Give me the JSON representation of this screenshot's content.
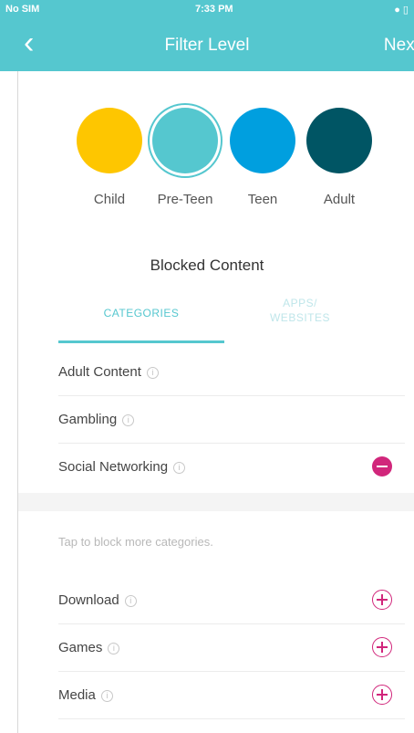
{
  "status_bar": {
    "carrier": "No SIM",
    "time": "7:33 PM",
    "battery": "● ▯"
  },
  "header": {
    "back_icon": "‹",
    "title": "Filter Level",
    "next_label": "Next"
  },
  "levels": [
    {
      "name": "Child",
      "color": "#fec600",
      "selected": false
    },
    {
      "name": "Pre-Teen",
      "color": "#55c7cf",
      "selected": true
    },
    {
      "name": "Teen",
      "color": "#009fdf",
      "selected": false
    },
    {
      "name": "Adult",
      "color": "#005564",
      "selected": false
    }
  ],
  "blocked_title": "Blocked Content",
  "tabs": {
    "categories_label": "CATEGORIES",
    "apps_label_line1": "APPS/",
    "apps_label_line2": "WEBSITES"
  },
  "blocked_categories": [
    {
      "label": "Adult Content",
      "action": "none"
    },
    {
      "label": "Gambling",
      "action": "none"
    },
    {
      "label": "Social Networking",
      "action": "remove"
    }
  ],
  "hint_text": "Tap to block more categories.",
  "more_categories": [
    {
      "label": "Download",
      "action": "add"
    },
    {
      "label": "Games",
      "action": "add"
    },
    {
      "label": "Media",
      "action": "add"
    }
  ],
  "icons": {
    "info": "i"
  },
  "colors": {
    "accent": "#55c7cf",
    "action": "#d1267b"
  }
}
